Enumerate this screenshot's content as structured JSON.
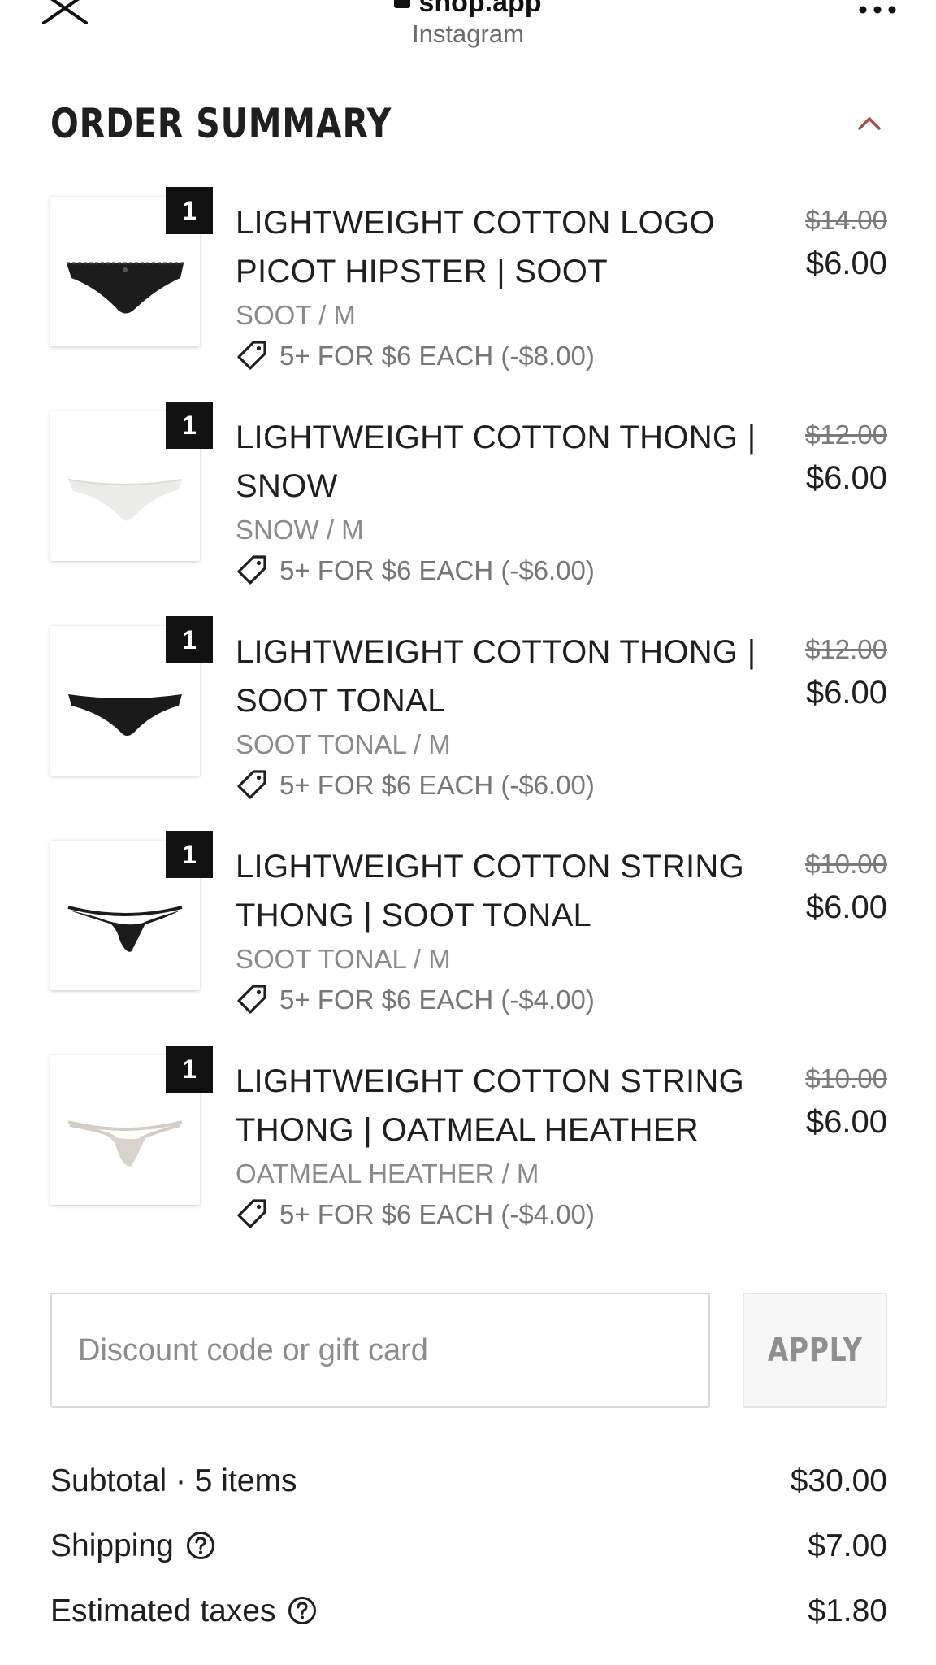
{
  "browser": {
    "address": "shop.app",
    "subtitle": "Instagram"
  },
  "summary": {
    "title": "ORDER SUMMARY"
  },
  "items": [
    {
      "quantity": "1",
      "name": "LIGHTWEIGHT COTTON LOGO PICOT HIPSTER | SOOT",
      "variant": "SOOT / M",
      "discount": "5+ FOR $6 EACH (-$8.00)",
      "original_price": "$14.00",
      "price": "$6.00",
      "product_color": "#1c1c1c"
    },
    {
      "quantity": "1",
      "name": "LIGHTWEIGHT COTTON THONG | SNOW",
      "variant": "SNOW / M",
      "discount": "5+ FOR $6 EACH (-$6.00)",
      "original_price": "$12.00",
      "price": "$6.00",
      "product_color": "#f2f2f0"
    },
    {
      "quantity": "1",
      "name": "LIGHTWEIGHT COTTON THONG | SOOT TONAL",
      "variant": "SOOT TONAL / M",
      "discount": "5+ FOR $6 EACH (-$6.00)",
      "original_price": "$12.00",
      "price": "$6.00",
      "product_color": "#1a1a1a"
    },
    {
      "quantity": "1",
      "name": "LIGHTWEIGHT COTTON STRING THONG | SOOT TONAL",
      "variant": "SOOT TONAL / M",
      "discount": "5+ FOR $6 EACH (-$4.00)",
      "original_price": "$10.00",
      "price": "$6.00",
      "product_color": "#1c1c1c"
    },
    {
      "quantity": "1",
      "name": "LIGHTWEIGHT COTTON STRING THONG | OATMEAL HEATHER",
      "variant": "OATMEAL HEATHER / M",
      "discount": "5+ FOR $6 EACH (-$4.00)",
      "original_price": "$10.00",
      "price": "$6.00",
      "product_color": "#d9d3cb"
    }
  ],
  "discount_code": {
    "placeholder": "Discount code or gift card",
    "apply_label": "APPLY"
  },
  "totals": {
    "subtotal_label": "Subtotal · 5 items",
    "subtotal_value": "$30.00",
    "shipping_label": "Shipping",
    "shipping_value": "$7.00",
    "taxes_label": "Estimated taxes",
    "taxes_value": "$1.80"
  },
  "colors": {
    "accent": "#a0524a",
    "text": "#1f1f1f",
    "muted": "#8a8a8a"
  }
}
